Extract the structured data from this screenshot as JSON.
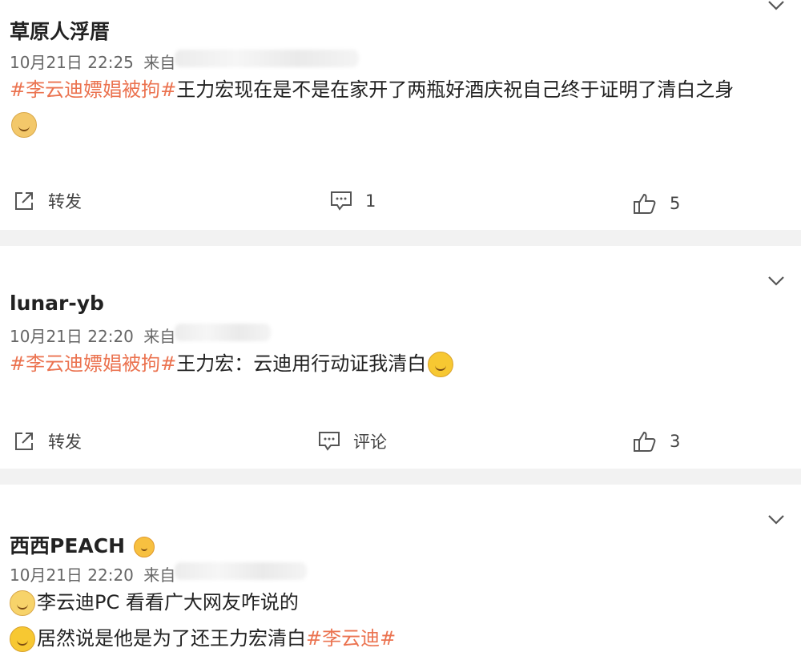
{
  "posts": [
    {
      "username": "草原人浮厝",
      "time": "10月21日 22:25",
      "from_label": "来自",
      "topic": "#李云迪嫖娼被拘#",
      "text": "王力宏现在是不是在家开了两瓶好酒庆祝自己终于证明了清白之身",
      "actions": {
        "repost": "转发",
        "comment": "1",
        "like": "5"
      }
    },
    {
      "username": "lunar-yb",
      "time": "10月21日 22:20",
      "from_label": "来自",
      "topic": "#李云迪嫖娼被拘#",
      "text": "王力宏：云迪用行动证我清白",
      "actions": {
        "repost": "转发",
        "comment": "评论",
        "like": "3"
      }
    },
    {
      "username": "西西PEACH",
      "time": "10月21日 22:20",
      "from_label": "来自",
      "line1": "李云迪PC 看看广大网友咋说的",
      "line2_text": "居然说是他是为了还王力宏清白",
      "line2_topic": "#李云迪#"
    }
  ],
  "icons": {
    "chevron": "chevron-down-icon",
    "repost": "share-icon",
    "comment": "comment-icon",
    "like": "thumbs-up-icon"
  },
  "colors": {
    "topic": "#eb7350",
    "separator": "#f2f2f2"
  }
}
